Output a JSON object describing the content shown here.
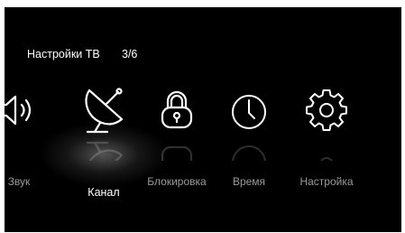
{
  "header": {
    "title": "Настройки ТВ",
    "page": "3/6"
  },
  "menu": {
    "items": [
      {
        "label": "Звук",
        "icon": "speaker-icon",
        "selected": false
      },
      {
        "label": "Канал",
        "icon": "satellite-dish-icon",
        "selected": true
      },
      {
        "label": "Блокировка",
        "icon": "lock-icon",
        "selected": false
      },
      {
        "label": "Время",
        "icon": "clock-icon",
        "selected": false
      },
      {
        "label": "Настройка",
        "icon": "gear-icon",
        "selected": false
      }
    ]
  },
  "colors": {
    "background": "#000000",
    "icon": "#ffffff",
    "label_inactive": "#9a9a9a",
    "label_active": "#ffffff"
  }
}
